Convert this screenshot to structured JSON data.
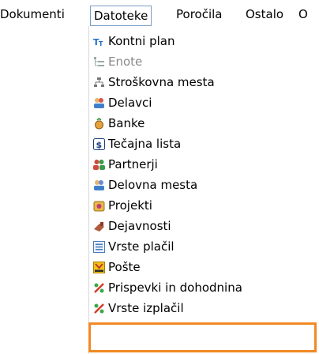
{
  "menubar": {
    "items": [
      {
        "label": "Dokumenti"
      },
      {
        "label": "Datoteke"
      },
      {
        "label": "Poročila"
      },
      {
        "label": "Ostalo"
      },
      {
        "label": "O"
      }
    ]
  },
  "dropdown": {
    "items": [
      {
        "label": "Kontni plan",
        "icon": "text-type-icon",
        "disabled": false
      },
      {
        "label": "Enote",
        "icon": "tree-list-icon",
        "disabled": true
      },
      {
        "label": "Stroškovna mesta",
        "icon": "hierarchy-icon",
        "disabled": false
      },
      {
        "label": "Delavci",
        "icon": "workers-icon",
        "disabled": false
      },
      {
        "label": "Banke",
        "icon": "money-bag-icon",
        "disabled": false
      },
      {
        "label": "Tečajna lista",
        "icon": "dollar-icon",
        "disabled": false
      },
      {
        "label": "Partnerji",
        "icon": "partners-icon",
        "disabled": false
      },
      {
        "label": "Delovna mesta",
        "icon": "workplaces-icon",
        "disabled": false
      },
      {
        "label": "Projekti",
        "icon": "projects-icon",
        "disabled": false
      },
      {
        "label": "Dejavnosti",
        "icon": "activity-icon",
        "disabled": false
      },
      {
        "label": "Vrste plačil",
        "icon": "list-icon",
        "disabled": false
      },
      {
        "label": "Pošte",
        "icon": "post-icon",
        "disabled": false
      },
      {
        "label": "Prispevki in dohodnina",
        "icon": "percent-icon",
        "disabled": false
      },
      {
        "label": "Vrste izplačil",
        "icon": "percent-icon",
        "disabled": false
      }
    ]
  },
  "colors": {
    "highlight": "#f08a24",
    "active_border": "#7a9ec6"
  }
}
